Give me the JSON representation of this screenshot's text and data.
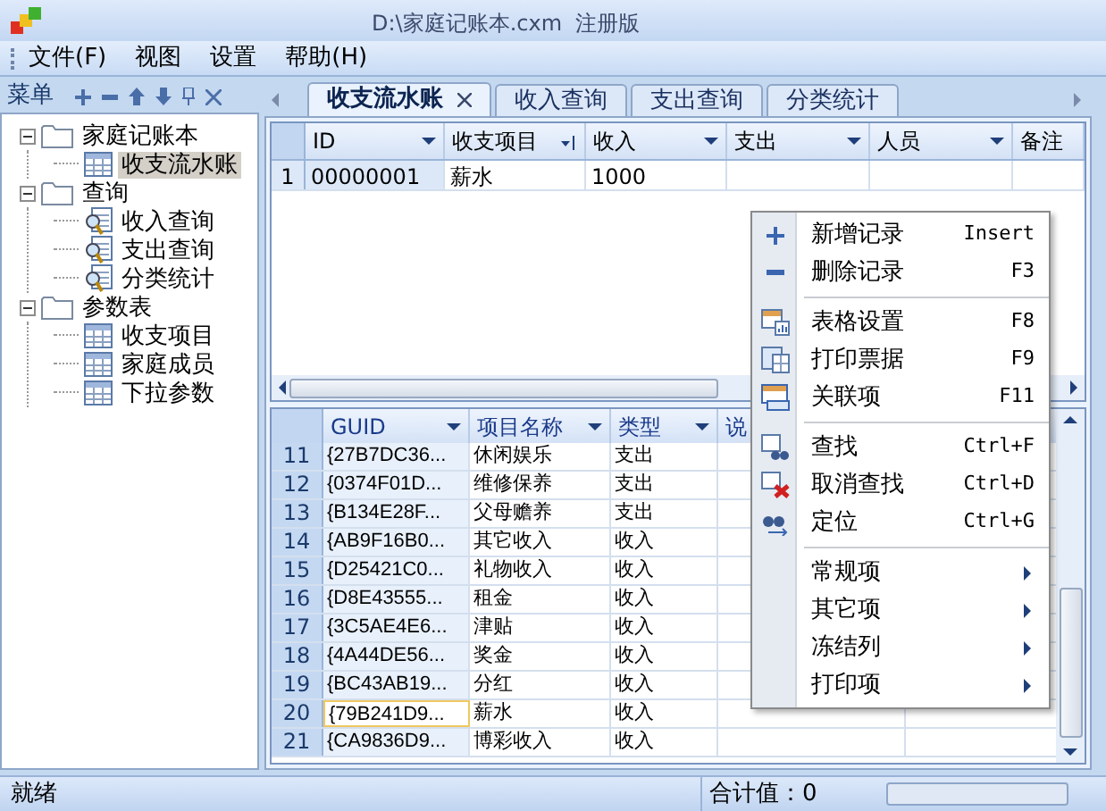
{
  "window": {
    "title": "D:\\家庭记账本.cxm  注册版"
  },
  "menu_bar": [
    "文件(F)",
    "视图",
    "设置",
    "帮助(H)"
  ],
  "sidebar": {
    "title": "菜单",
    "tree": [
      {
        "label": "家庭记账本",
        "kind": "folder",
        "expanded": true,
        "selected": false,
        "children": [
          {
            "label": "收支流水账",
            "kind": "table",
            "selected": true
          }
        ]
      },
      {
        "label": "查询",
        "kind": "folder",
        "expanded": true,
        "selected": false,
        "children": [
          {
            "label": "收入查询",
            "kind": "query",
            "selected": false
          },
          {
            "label": "支出查询",
            "kind": "query",
            "selected": false
          },
          {
            "label": "分类统计",
            "kind": "query",
            "selected": false
          }
        ]
      },
      {
        "label": "参数表",
        "kind": "folder",
        "expanded": true,
        "selected": false,
        "children": [
          {
            "label": "收支项目",
            "kind": "table",
            "selected": false
          },
          {
            "label": "家庭成员",
            "kind": "table",
            "selected": false
          },
          {
            "label": "下拉参数",
            "kind": "table",
            "selected": false
          }
        ]
      }
    ]
  },
  "tabs": [
    {
      "label": "收支流水账",
      "selected": true
    },
    {
      "label": "收入查询",
      "selected": false
    },
    {
      "label": "支出查询",
      "selected": false
    },
    {
      "label": "分类统计",
      "selected": false
    }
  ],
  "upper_table": {
    "columns": [
      {
        "label": "ID",
        "sorted": false
      },
      {
        "label": "收支项目",
        "sorted": true
      },
      {
        "label": "收入",
        "sorted": false
      },
      {
        "label": "支出",
        "sorted": false
      },
      {
        "label": "人员",
        "sorted": false
      },
      {
        "label": "备注",
        "sorted": false
      }
    ],
    "rows": [
      {
        "number": "1",
        "cells": [
          "00000001",
          "薪水",
          "1000",
          "",
          "",
          ""
        ]
      }
    ]
  },
  "lower_table": {
    "columns": [
      "GUID",
      "项目名称",
      "类型",
      "说"
    ],
    "rows": [
      {
        "number": "11",
        "cells": [
          "{27B7DC36...",
          "休闲娱乐",
          "支出"
        ],
        "focused": false
      },
      {
        "number": "12",
        "cells": [
          "{0374F01D...",
          "维修保养",
          "支出"
        ],
        "focused": false
      },
      {
        "number": "13",
        "cells": [
          "{B134E28F...",
          "父母赡养",
          "支出"
        ],
        "focused": false
      },
      {
        "number": "14",
        "cells": [
          "{AB9F16B0...",
          "其它收入",
          "收入"
        ],
        "focused": false
      },
      {
        "number": "15",
        "cells": [
          "{D25421C0...",
          "礼物收入",
          "收入"
        ],
        "focused": false
      },
      {
        "number": "16",
        "cells": [
          "{D8E43555...",
          "租金",
          "收入"
        ],
        "focused": false
      },
      {
        "number": "17",
        "cells": [
          "{3C5AE4E6...",
          "津贴",
          "收入"
        ],
        "focused": false
      },
      {
        "number": "18",
        "cells": [
          "{4A44DE56...",
          "奖金",
          "收入"
        ],
        "focused": false
      },
      {
        "number": "19",
        "cells": [
          "{BC43AB19...",
          "分红",
          "收入"
        ],
        "focused": false
      },
      {
        "number": "20",
        "cells": [
          "{79B241D9...",
          "薪水",
          "收入"
        ],
        "focused": true
      },
      {
        "number": "21",
        "cells": [
          "{CA9836D9...",
          "博彩收入",
          "收入"
        ],
        "focused": false
      }
    ]
  },
  "context_menu": {
    "groups": [
      [
        {
          "kind": "command",
          "label": "新增记录",
          "shortcut": "Insert"
        },
        {
          "kind": "command",
          "label": "删除记录",
          "shortcut": "F3"
        }
      ],
      [
        {
          "kind": "command",
          "label": "表格设置",
          "shortcut": "F8"
        },
        {
          "kind": "command",
          "label": "打印票据",
          "shortcut": "F9"
        },
        {
          "kind": "command",
          "label": "关联项",
          "shortcut": "F11"
        }
      ],
      [
        {
          "kind": "command",
          "label": "查找",
          "shortcut": "Ctrl+F"
        },
        {
          "kind": "command",
          "label": "取消查找",
          "shortcut": "Ctrl+D"
        },
        {
          "kind": "command",
          "label": "定位",
          "shortcut": "Ctrl+G"
        }
      ],
      [
        {
          "kind": "submenu",
          "label": "常规项"
        },
        {
          "kind": "submenu",
          "label": "其它项"
        },
        {
          "kind": "submenu",
          "label": "冻结列"
        },
        {
          "kind": "submenu",
          "label": "打印项"
        }
      ]
    ]
  },
  "status_bar": {
    "status": "就绪",
    "total": "合计值：0",
    "progress": {
      "level": 0
    }
  }
}
